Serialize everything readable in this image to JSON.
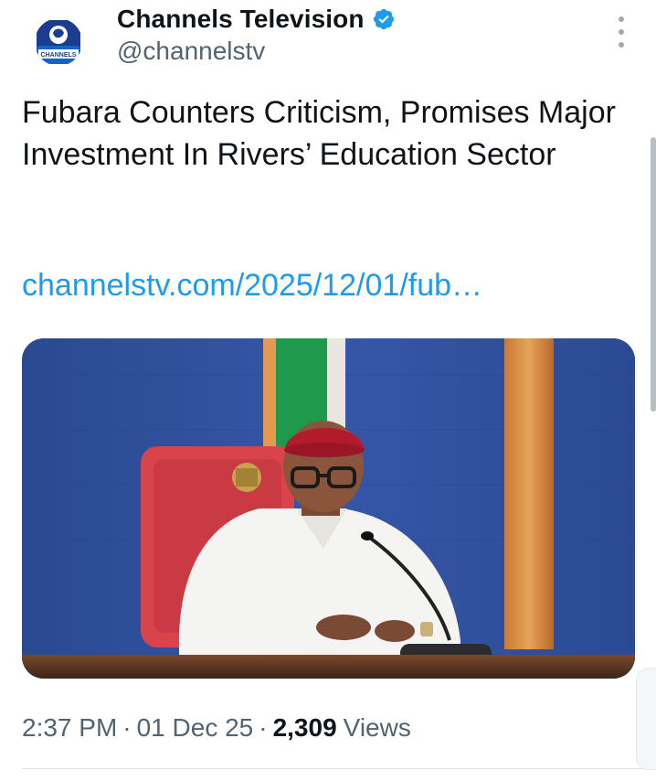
{
  "account": {
    "display_name": "Channels Television",
    "handle": "@channelstv",
    "avatar_text": "CHANNELS",
    "verified_icon": "verified-badge-icon",
    "verified_color": "#1d9bf0"
  },
  "post": {
    "text": "Fubara Counters Criticism, Promises Major Investment In Rivers’ Education Sector",
    "link": "channelstv.com/2025/12/01/fub…",
    "media_icon": "photo",
    "time": "2:37 PM",
    "date": "01 Dec 25",
    "separator": "·",
    "views_count": "2,309",
    "views_label": "Views"
  },
  "ui": {
    "more_icon": "more-vertical-icon",
    "link_color": "#1d9bf0",
    "secondary_text_color": "#536471"
  }
}
